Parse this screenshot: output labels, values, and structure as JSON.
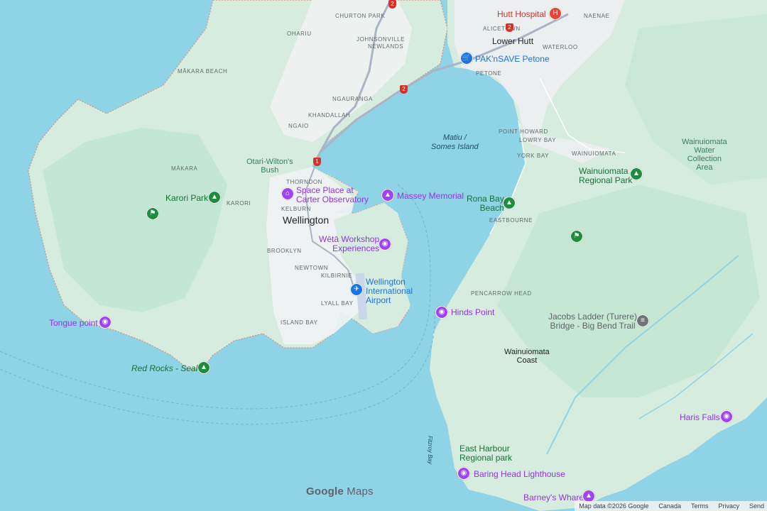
{
  "colors": {
    "water": "#8fd3e6",
    "land": "#dcefe3",
    "park": "#bfe6cf",
    "urban": "#f1f3f4",
    "road": "#9aa0a6",
    "highway": "#aab4c4",
    "border": "#e06c5f"
  },
  "places": {
    "churton_park": "CHURTON PARK",
    "ohariu": "OHARIU",
    "johnsonville": "JOHNSONVILLE",
    "newlands": "NEWLANDS",
    "makara_beach": "MĀKARA BEACH",
    "ngauranga": "NGAURANGA",
    "khandallah": "KHANDALLAH",
    "ngaio": "NGAIO",
    "makara": "MĀKARA",
    "thorndon": "THORNDON",
    "karori": "KARORI",
    "kelburn": "KELBURN",
    "brooklyn": "BROOKLYN",
    "newtown": "NEWTOWN",
    "kilbirnie": "KILBIRNIE",
    "lyall_bay": "LYALL BAY",
    "island_bay": "ISLAND BAY",
    "alicetown": "ALICETOWN",
    "naenae": "NAENAE",
    "waterloo": "WATERLOO",
    "petone": "PETONE",
    "point_howard": "POINT HOWARD",
    "lowry_bay": "LOWRY BAY",
    "york_bay": "YORK BAY",
    "eastbourne": "EASTBOURNE",
    "wainuiomata_suburb": "WAINUIOMATA",
    "pencarrow_head": "PENCARROW HEAD"
  },
  "cities": {
    "wellington": "Wellington",
    "lower_hutt": "Lower Hutt"
  },
  "areas": {
    "otari": [
      "Otari-Wilton's",
      "Bush"
    ],
    "wainuiomata_coast": [
      "Wainuiomata",
      "Coast"
    ],
    "water_collection": [
      "Wainuiomata",
      "Water",
      "Collection",
      "Area"
    ],
    "matiu": [
      "Matiu /",
      "Somes Island"
    ],
    "fitzroy_bay": "Fitzroy Bay"
  },
  "pois": {
    "hutt_hospital": "Hutt Hospital",
    "paknsave": "PAK'nSAVE Petone",
    "space_place": [
      "Space Place at",
      "Carter Observatory"
    ],
    "massey": "Massey Memorial",
    "weta": [
      "Wētā Workshop",
      "Experiences"
    ],
    "airport": [
      "Wellington",
      "International",
      "Airport"
    ],
    "karori_park": "Karori Park",
    "tongue_point": "Tongue point",
    "red_rocks": "Red Rocks - Seals",
    "rona_bay": [
      "Rona Bay",
      "Beach"
    ],
    "wainuiomata_park": [
      "Wainuiomata",
      "Regional Park"
    ],
    "hinds_point": "Hinds Point",
    "jacobs_ladder": [
      "Jacobs Ladder (Turere)",
      "Bridge - Big Bend Trail"
    ],
    "haris_falls": "Haris Falls",
    "east_harbour": [
      "East Harbour",
      "Regional park"
    ],
    "baring_head": "Baring Head Lighthouse",
    "barneys_whare": "Barney's Whare"
  },
  "routes": {
    "r1": "1",
    "r2a": "2",
    "r2b": "2",
    "r2c": "2"
  },
  "branding": {
    "google": "Google",
    "maps": "Maps"
  },
  "attribution": {
    "data": "Map data ©2026 Google",
    "country": "Canada",
    "terms": "Terms",
    "privacy": "Privacy",
    "send": "Send"
  }
}
